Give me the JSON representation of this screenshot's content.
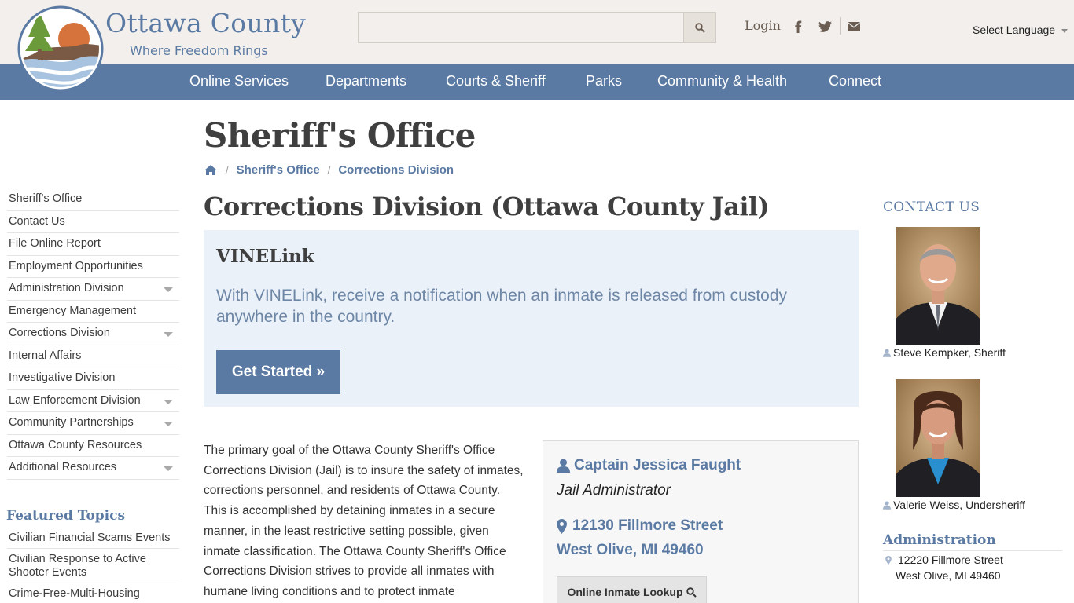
{
  "header": {
    "brand_title": "Ottawa County",
    "brand_tagline": "Where Freedom Rings",
    "search_placeholder": "",
    "login_label": "Login",
    "language_label": "Select Language",
    "icons": [
      "search-icon",
      "facebook-icon",
      "twitter-icon",
      "envelope-icon"
    ]
  },
  "nav": {
    "items": [
      {
        "label": "Online Services"
      },
      {
        "label": "Departments"
      },
      {
        "label": "Courts & Sheriff"
      },
      {
        "label": "Parks"
      },
      {
        "label": "Community & Health"
      },
      {
        "label": "Connect"
      }
    ]
  },
  "page": {
    "title": "Sheriff's Office",
    "subtitle": "Corrections Division (Ottawa County Jail)"
  },
  "breadcrumb": {
    "home_icon": "home-icon",
    "items": [
      "Sheriff's Office",
      "Corrections Division"
    ],
    "separator": "/"
  },
  "sidebar": {
    "items": [
      {
        "label": "Sheriff's Office"
      },
      {
        "label": "Contact Us"
      },
      {
        "label": "File Online Report"
      },
      {
        "label": "Employment Opportunities"
      },
      {
        "label": "Administration Division"
      },
      {
        "label": "Emergency Management"
      },
      {
        "label": "Corrections Division"
      },
      {
        "label": "Internal Affairs"
      },
      {
        "label": "Investigative Division"
      },
      {
        "label": "Law Enforcement Division"
      },
      {
        "label": "Community Partnerships"
      },
      {
        "label": "Ottawa County Resources"
      },
      {
        "label": "Additional Resources"
      }
    ],
    "featured_title": "Featured Topics",
    "featured": [
      {
        "label": "Civilian Financial Scams Events"
      },
      {
        "label": "Civilian Response to Active Shooter Events"
      },
      {
        "label": "Crime-Free-Multi-Housing"
      }
    ]
  },
  "vinelink": {
    "title": "VINELink",
    "text": "With VINELink, receive a notification when an inmate is released from custody anywhere in the country.",
    "button_label": "Get Started »"
  },
  "body": {
    "paragraph": "The primary goal of the Ottawa County Sheriff's Office Corrections Division (Jail) is to insure the safety of inmates, corrections personnel, and residents of Ottawa County. This is accomplished by detaining inmates in a secure manner, in the least restrictive setting possible, given inmate classification. The Ottawa County Sheriff's Office Corrections Division strives to provide all inmates with humane living conditions and to protect inmate"
  },
  "contact_card": {
    "name": "Captain Jessica Faught",
    "role": "Jail Administrator",
    "address_line1": "12130 Fillmore Street",
    "address_line2": "West Olive, MI 49460",
    "button_label": "Online Inmate Lookup"
  },
  "right": {
    "contact_heading": "CONTACT US",
    "people": [
      {
        "caption": "Steve Kempker, Sheriff"
      },
      {
        "caption": "Valerie Weiss, Undersheriff"
      }
    ],
    "admin_heading": "Administration",
    "admin_address1": "12220 Fillmore Street",
    "admin_address2": "West Olive, MI 49460"
  },
  "colors": {
    "brand_blue": "#5b7aa3",
    "header_bg": "#f2efec",
    "vine_bg": "#eaf1f8",
    "text_dark": "#3f3f3f"
  }
}
